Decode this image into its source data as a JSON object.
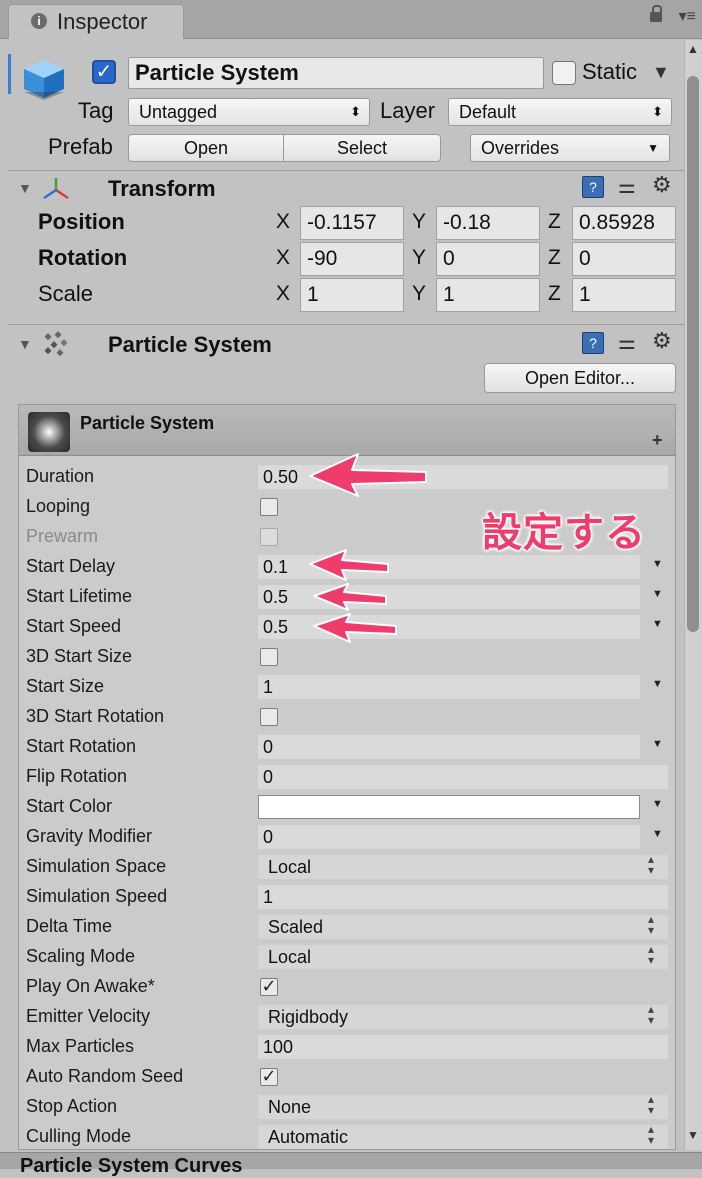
{
  "tab": {
    "title": "Inspector",
    "menu_glyph": "▾≡"
  },
  "header": {
    "active_checked": true,
    "object_name": "Particle System",
    "static_label": "Static",
    "tag_label": "Tag",
    "tag_value": "Untagged",
    "layer_label": "Layer",
    "layer_value": "Default",
    "prefab_label": "Prefab",
    "open_label": "Open",
    "select_label": "Select",
    "overrides_label": "Overrides"
  },
  "transform": {
    "title": "Transform",
    "rows": [
      {
        "label": "Position",
        "x": "-0.1157",
        "y": "-0.18",
        "z": "0.85928"
      },
      {
        "label": "Rotation",
        "x": "-90",
        "y": "0",
        "z": "0"
      },
      {
        "label": "Scale",
        "x": "1",
        "y": "1",
        "z": "1"
      }
    ],
    "axis_x": "X",
    "axis_y": "Y",
    "axis_z": "Z"
  },
  "particle_component": {
    "title": "Particle System",
    "open_editor_label": "Open Editor...",
    "module_title": "Particle System",
    "plus": "+"
  },
  "properties": [
    {
      "name": "Duration",
      "value": "0.50"
    },
    {
      "name": "Looping",
      "checkbox": false
    },
    {
      "name": "Prewarm",
      "checkbox": false,
      "disabled": true
    },
    {
      "name": "Start Delay",
      "value": "0.1"
    },
    {
      "name": "Start Lifetime",
      "value": "0.5"
    },
    {
      "name": "Start Speed",
      "value": "0.5"
    },
    {
      "name": "3D Start Size",
      "checkbox": false
    },
    {
      "name": "Start Size",
      "value": "1"
    },
    {
      "name": "3D Start Rotation",
      "checkbox": false
    },
    {
      "name": "Start Rotation",
      "value": "0"
    },
    {
      "name": "Flip Rotation",
      "value": "0"
    },
    {
      "name": "Start Color",
      "color": "#ffffff"
    },
    {
      "name": "Gravity Modifier",
      "value": "0"
    },
    {
      "name": "Simulation Space",
      "value": "Local"
    },
    {
      "name": "Simulation Speed",
      "value": "1"
    },
    {
      "name": "Delta Time",
      "value": "Scaled"
    },
    {
      "name": "Scaling Mode",
      "value": "Local"
    },
    {
      "name": "Play On Awake*",
      "checkbox": true
    },
    {
      "name": "Emitter Velocity",
      "value": "Rigidbody"
    },
    {
      "name": "Max Particles",
      "value": "100"
    },
    {
      "name": "Auto Random Seed",
      "checkbox": true
    },
    {
      "name": "Stop Action",
      "value": "None"
    },
    {
      "name": "Culling Mode",
      "value": "Automatic"
    }
  ],
  "annotation": {
    "text": "設定する",
    "color": "#ee3c6c"
  },
  "footer": {
    "title": "Particle System Curves"
  }
}
